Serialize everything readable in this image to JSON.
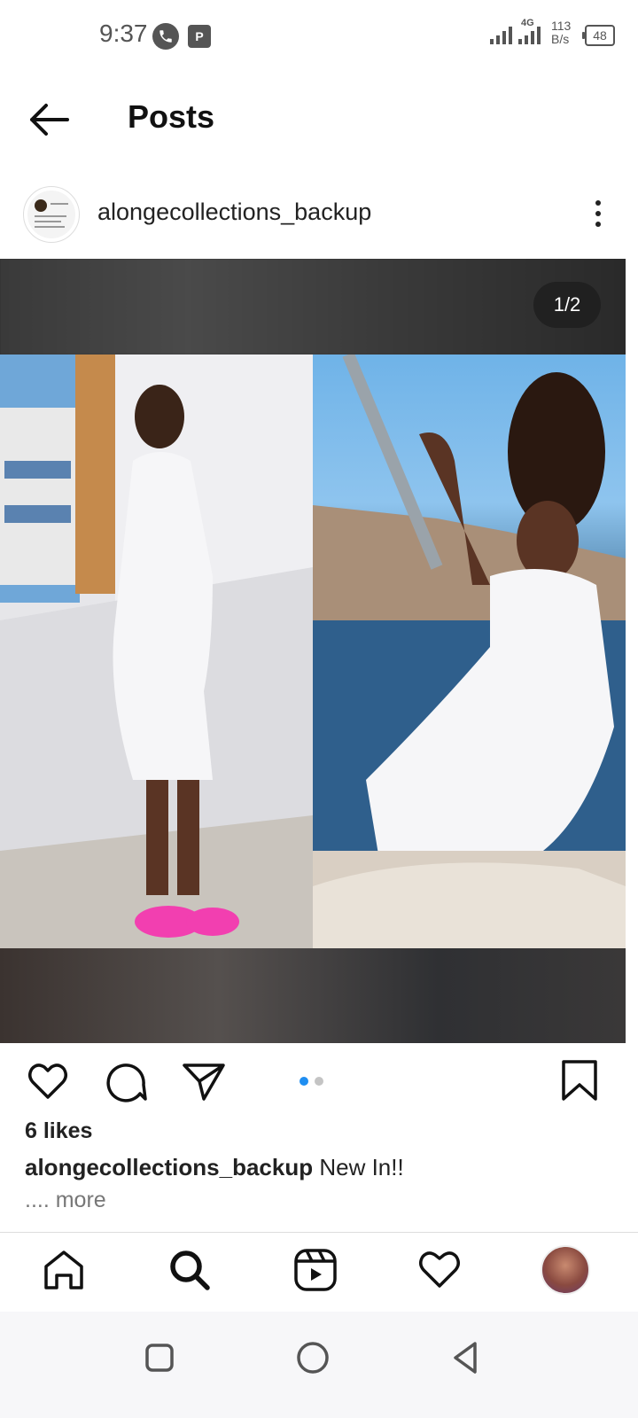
{
  "status_bar": {
    "time": "9:37",
    "call_icon": "phone-icon",
    "app_icon_text": "P",
    "network_tag": "4G",
    "speed_value": "113",
    "speed_unit": "B/s",
    "battery": "48"
  },
  "header": {
    "title": "Posts",
    "back_icon": "arrow-left-icon"
  },
  "post": {
    "username": "alongecollections_backup",
    "page_counter": "1/2",
    "likes": "6 likes",
    "caption_user": "alongecollections_backup",
    "caption_text": "New In!!",
    "more_text": ".... more",
    "carousel_active_color": "#1f8ef1",
    "carousel_inactive_color": "#c4c4c4"
  },
  "actions": {
    "icons": [
      "heart-icon",
      "comment-icon",
      "share-icon",
      "bookmark-icon"
    ]
  },
  "bottom_nav": {
    "items": [
      "home-icon",
      "search-icon",
      "reels-icon",
      "heart-icon",
      "profile-avatar"
    ]
  },
  "system_nav": {
    "items": [
      "recents-square-icon",
      "home-circle-icon",
      "back-triangle-icon"
    ]
  }
}
